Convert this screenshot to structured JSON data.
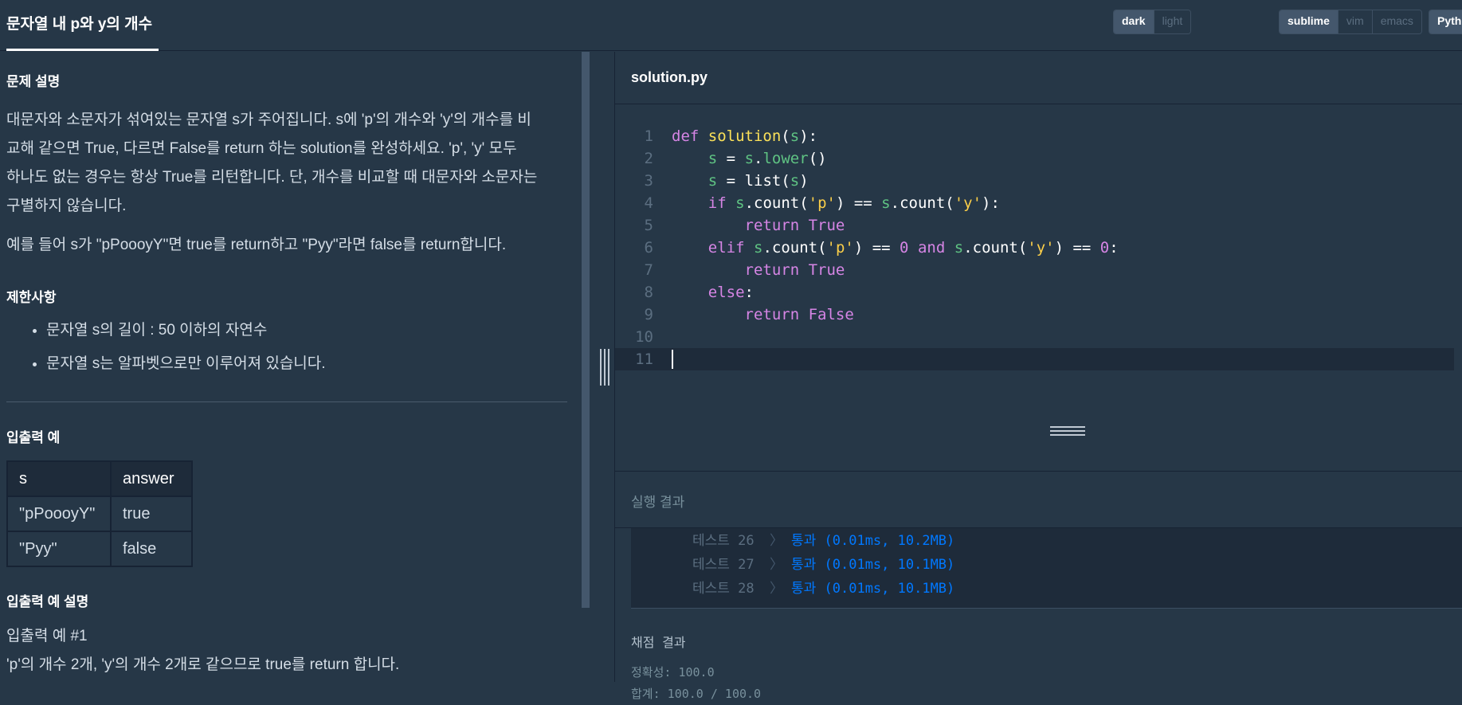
{
  "header": {
    "title": "문자열 내 p와 y의 개수",
    "theme_options": [
      "dark",
      "light"
    ],
    "theme_selected": "dark",
    "keymap_options": [
      "sublime",
      "vim",
      "emacs"
    ],
    "keymap_selected": "sublime",
    "language": "Pyth"
  },
  "problem": {
    "desc_heading": "문제 설명",
    "desc_lines": [
      "대문자와 소문자가 섞여있는 문자열 s가 주어집니다. s에 'p'의 개수와 'y'의 개수를 비",
      "교해 같으면 True, 다르면 False를 return 하는 solution를 완성하세요. 'p', 'y' 모두",
      "하나도 없는 경우는 항상 True를 리턴합니다. 단, 개수를 비교할 때 대문자와 소문자는",
      "구별하지 않습니다."
    ],
    "example_text": "예를 들어 s가 \"pPoooyY\"면 true를 return하고 \"Pyy\"라면 false를 return합니다.",
    "limits_heading": "제한사항",
    "limits": [
      "문자열 s의 길이 : 50 이하의 자연수",
      "문자열 s는 알파벳으로만 이루어져 있습니다."
    ],
    "io_heading": "입출력 예",
    "io_table": {
      "headers": [
        "s",
        "answer"
      ],
      "rows": [
        [
          "\"pPoooyY\"",
          "true"
        ],
        [
          "\"Pyy\"",
          "false"
        ]
      ]
    },
    "io_desc_heading": "입출력 예 설명",
    "io_example_title": "입출력 예 #1",
    "io_example_text": "'p'의 개수 2개, 'y'의 개수 2개로 같으므로 true를 return 합니다."
  },
  "editor": {
    "filename": "solution.py",
    "line_numbers": [
      "1",
      "2",
      "3",
      "4",
      "5",
      "6",
      "7",
      "8",
      "9",
      "10",
      "11"
    ]
  },
  "results": {
    "heading": "실행 결과",
    "tests": [
      {
        "name": "테스트 26",
        "chevron": "〉",
        "result": "통과 (0.01ms, 10.2MB)"
      },
      {
        "name": "테스트 27",
        "chevron": "〉",
        "result": "통과 (0.01ms, 10.1MB)"
      },
      {
        "name": "테스트 28",
        "chevron": "〉",
        "result": "통과 (0.01ms, 10.1MB)"
      }
    ],
    "grade_heading": "채점 결과",
    "accuracy": "정확성: 100.0",
    "total": "합계: 100.0 / 100.0"
  }
}
